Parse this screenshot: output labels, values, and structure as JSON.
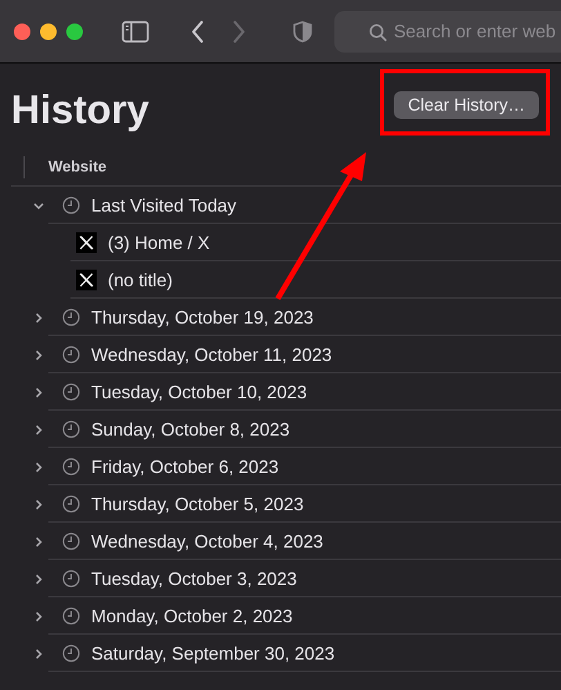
{
  "toolbar": {
    "search": {
      "placeholder": "Search or enter web"
    }
  },
  "title": "History",
  "clear_button": "Clear History…",
  "table": {
    "columns": [
      "Website"
    ],
    "rows": [
      {
        "label": "Last Visited Today",
        "expanded": true,
        "children": [
          {
            "label": "(3) Home / X"
          },
          {
            "label": "(no title)"
          }
        ]
      },
      {
        "label": "Thursday, October 19, 2023",
        "expanded": false
      },
      {
        "label": "Wednesday, October 11, 2023",
        "expanded": false
      },
      {
        "label": "Tuesday, October 10, 2023",
        "expanded": false
      },
      {
        "label": "Sunday, October 8, 2023",
        "expanded": false
      },
      {
        "label": "Friday, October 6, 2023",
        "expanded": false
      },
      {
        "label": "Thursday, October 5, 2023",
        "expanded": false
      },
      {
        "label": "Wednesday, October 4, 2023",
        "expanded": false
      },
      {
        "label": "Tuesday, October 3, 2023",
        "expanded": false
      },
      {
        "label": "Monday, October 2, 2023",
        "expanded": false
      },
      {
        "label": "Saturday, September 30, 2023",
        "expanded": false
      }
    ]
  }
}
